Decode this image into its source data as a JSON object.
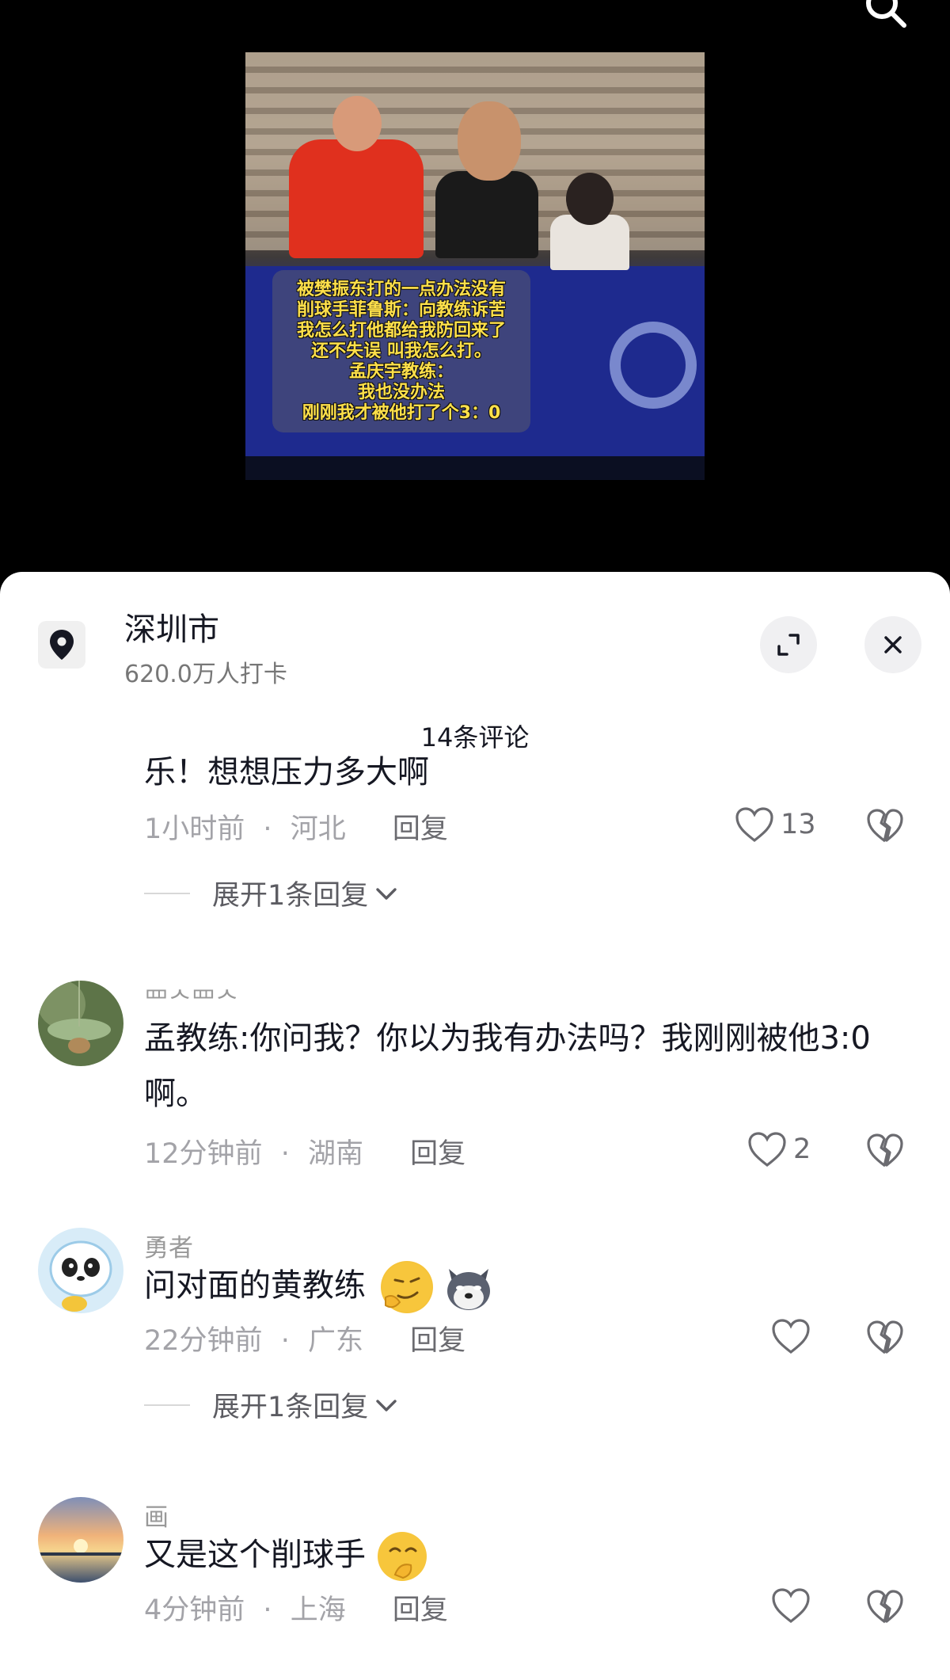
{
  "video": {
    "caption_lines": [
      "被樊振东打的一点办法没有",
      "削球手菲鲁斯：向教练诉苦",
      "我怎么打他都给我防回来了",
      "还不失误 叫我怎么打。",
      "孟庆宇教练：",
      "我也没办法",
      "刚刚我才被他打了个3：0"
    ]
  },
  "location": {
    "name": "深圳市",
    "checkins": "620.0万人打卡"
  },
  "comments_header": "14条评论",
  "comments": [
    {
      "partial_text": "乐！想想压力多大啊",
      "time": "1小时前",
      "region": "河北",
      "reply": "回复",
      "likes": "13",
      "expand": "展开1条回复"
    },
    {
      "name": "罒ᄉ罒ᄉ",
      "text": "孟教练:你问我？你以为我有办法吗？我刚刚被他3:0啊。",
      "time": "12分钟前",
      "region": "湖南",
      "reply": "回复",
      "likes": "2"
    },
    {
      "name": "勇者",
      "text": "问对面的黄教练",
      "time": "22分钟前",
      "region": "广东",
      "reply": "回复",
      "likes": "",
      "expand": "展开1条回复"
    },
    {
      "name": "画",
      "text": "又是这个削球手",
      "time": "4分钟前",
      "region": "上海",
      "reply": "回复",
      "likes": ""
    }
  ],
  "icons": {
    "search": "search-icon",
    "location": "location-pin-icon",
    "expand": "fullscreen-icon",
    "close": "close-icon",
    "like": "heart-icon",
    "dislike": "broken-heart-icon"
  }
}
